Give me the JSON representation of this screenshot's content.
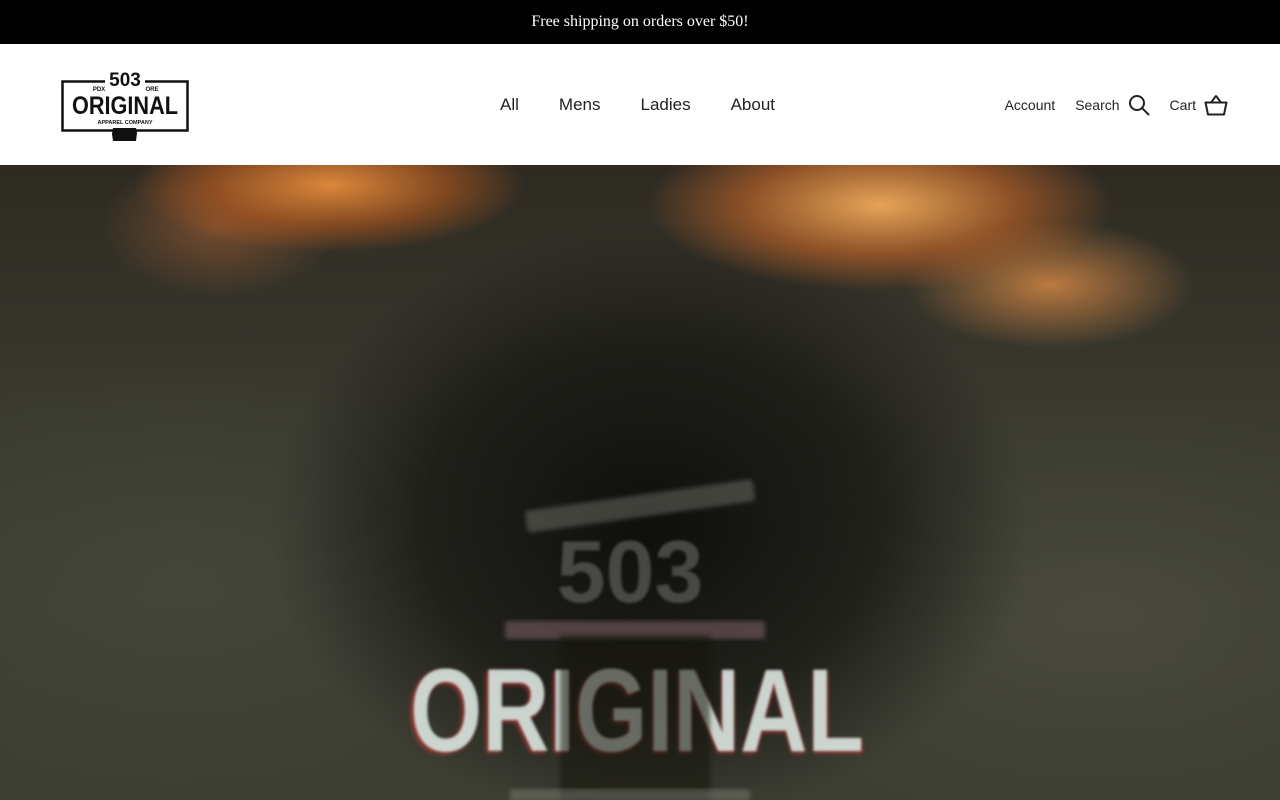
{
  "announcement": {
    "text": "Free shipping on orders over $50!"
  },
  "logo": {
    "number": "503",
    "name": "ORIGINAL",
    "left_tag": "PDX",
    "right_tag": "ORE",
    "tagline": "APPAREL COMPANY"
  },
  "nav": {
    "items": [
      {
        "label": "All"
      },
      {
        "label": "Mens"
      },
      {
        "label": "Ladies"
      },
      {
        "label": "About"
      }
    ]
  },
  "utilities": {
    "account_label": "Account",
    "search_label": "Search",
    "cart_label": "Cart",
    "search_icon": "search-icon",
    "cart_icon": "basket-icon"
  },
  "hero": {
    "number": "503",
    "name": "ORIGINAL",
    "accent_color": "#d7f0ea"
  },
  "colors": {
    "announcement_bg": "#000000",
    "header_bg": "#ffffff",
    "text": "#222222"
  }
}
